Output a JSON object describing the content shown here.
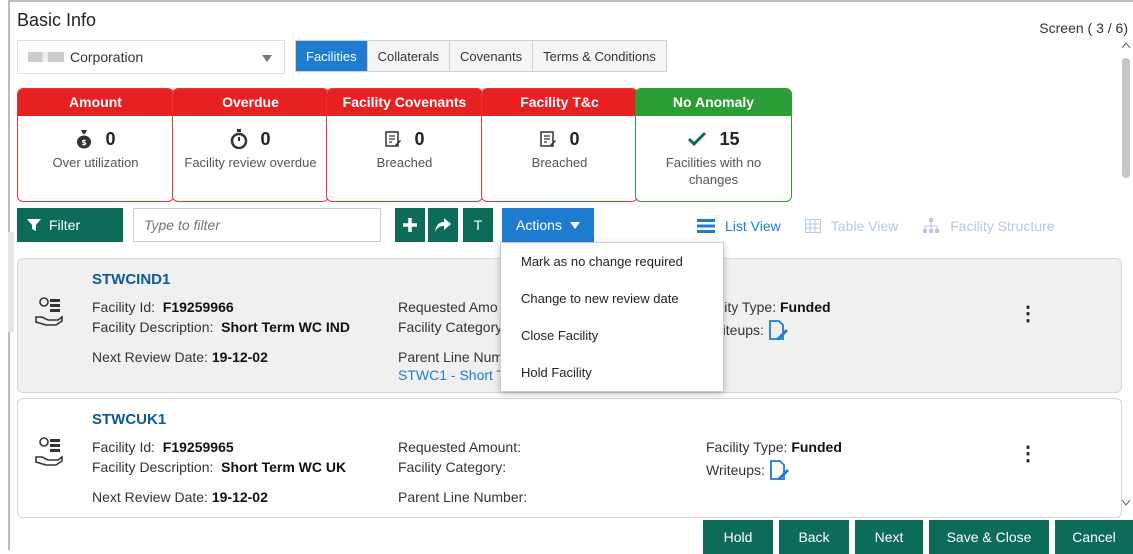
{
  "header": {
    "title": "Basic Info",
    "screen_indicator": "Screen ( 3 / 6)"
  },
  "corporation": {
    "value": "Corporation"
  },
  "tabs": [
    {
      "label": "Facilities",
      "active": true
    },
    {
      "label": "Collaterals",
      "active": false
    },
    {
      "label": "Covenants",
      "active": false
    },
    {
      "label": "Terms & Conditions",
      "active": false
    }
  ],
  "cards": [
    {
      "title": "Amount",
      "value": "0",
      "caption": "Over utilization",
      "color": "#e72122"
    },
    {
      "title": "Overdue",
      "value": "0",
      "caption": "Facility review overdue",
      "color": "#e72122"
    },
    {
      "title": "Facility Covenants",
      "value": "0",
      "caption": "Breached",
      "color": "#e72122"
    },
    {
      "title": "Facility T&c",
      "value": "0",
      "caption": "Breached",
      "color": "#e72122"
    },
    {
      "title": "No Anomaly",
      "value": "15",
      "caption": "Facilities with no changes",
      "color": "#2a9d34"
    }
  ],
  "toolbar": {
    "filter_label": "Filter",
    "filter_placeholder": "Type to filter",
    "t_label": "T",
    "actions_label": "Actions"
  },
  "views": {
    "list": "List View",
    "table": "Table View",
    "structure": "Facility Structure"
  },
  "actions_menu": [
    "Mark as no change required",
    "Change to new review date",
    "Close Facility",
    "Hold Facility"
  ],
  "facilities": [
    {
      "name": "STWCIND1",
      "facility_id_label": "Facility Id:",
      "facility_id": "F19259966",
      "description_label": "Facility Description:",
      "description": "Short Term WC IND",
      "review_label": "Next Review Date:",
      "review_date": "19-12-02",
      "requested_label": "Requested Amo",
      "category_label": "Facility Category",
      "parent_label": "Parent Line Num",
      "parent_value": "STWC1 - Short T",
      "type_label": "ility Type:",
      "type_value": "Funded",
      "writeups_label": "riteups:"
    },
    {
      "name": "STWCUK1",
      "facility_id_label": "Facility Id:",
      "facility_id": "F19259965",
      "description_label": "Facility Description:",
      "description": "Short Term WC UK",
      "review_label": "Next Review Date:",
      "review_date": "19-12-02",
      "requested_label": "Requested Amount:",
      "category_label": "Facility Category:",
      "parent_label": "Parent Line Number:",
      "type_label": "Facility Type:",
      "type_value": "Funded",
      "writeups_label": "Writeups:"
    }
  ],
  "footer": {
    "hold": "Hold",
    "back": "Back",
    "next": "Next",
    "save_close": "Save & Close",
    "cancel": "Cancel"
  }
}
